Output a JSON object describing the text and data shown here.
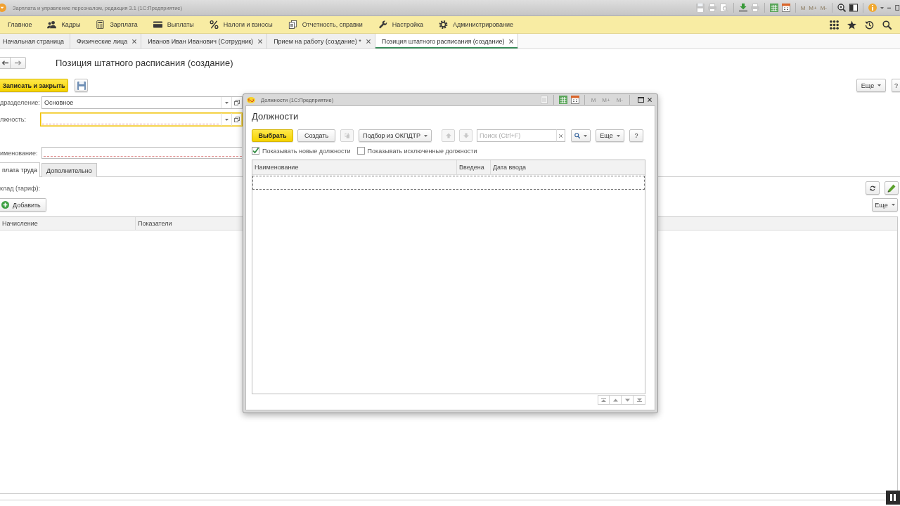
{
  "app_window": {
    "title": "Зарплата и управление персоналом, редакция 3.1  (1С:Предприятие)",
    "memory_buttons": [
      "M",
      "M+",
      "M-"
    ]
  },
  "sections_panel": {
    "items": [
      "Главное",
      "Кадры",
      "Зарплата",
      "Выплаты",
      "Налоги и взносы",
      "Отчетность, справки",
      "Настройка",
      "Администрирование"
    ]
  },
  "open_tabs": [
    {
      "label": "Начальная страница",
      "closable": false,
      "selected": false
    },
    {
      "label": "Физические лица",
      "closable": true,
      "selected": false
    },
    {
      "label": "Иванов Иван Иванович (Сотрудник)",
      "closable": true,
      "selected": false
    },
    {
      "label": "Прием на работу (создание) *",
      "closable": true,
      "selected": false
    },
    {
      "label": "Позиция штатного расписания (создание)",
      "closable": true,
      "selected": true
    }
  ],
  "form": {
    "title": "Позиция штатного расписания (создание)",
    "save_close_button": "Записать и закрыть",
    "more_button": "Еще",
    "help_button": "?",
    "fields": [
      {
        "kind": "choice",
        "label": "дразделение:",
        "value": "Основное",
        "focused": false,
        "needs_value": false
      },
      {
        "kind": "choice",
        "label": "лжность:",
        "focused": true,
        "needs_value": true
      },
      {
        "kind": "text",
        "label": "именование:",
        "focused": false,
        "needs_value": true
      }
    ],
    "tabs": [
      {
        "label": "плата труда",
        "selected": true
      },
      {
        "label": "Дополнительно",
        "selected": false
      }
    ],
    "salary_label": "клад (тариф):",
    "add_button": "Добавить",
    "table_more_button": "Еще",
    "table": {
      "columns": [
        "Начисление",
        "Показатели"
      ]
    }
  },
  "dialog": {
    "title": "Должности  (1С:Предприятие)",
    "memory_buttons": [
      "M",
      "M+",
      "M-"
    ],
    "heading": "Должности",
    "select_button": "Выбрать",
    "create_button": "Создать",
    "copy_button": {
      "disabled": true
    },
    "pick_button": "Подбор из ОКПДТР",
    "move_up_button": {
      "disabled": true
    },
    "move_down_button": {
      "disabled": true
    },
    "search": {
      "placeholder": "Поиск (Ctrl+F)"
    },
    "more_button": "Еще",
    "help_button": "?",
    "options": [
      {
        "label": "Показывать новые должности",
        "checked": true
      },
      {
        "label": "Показывать исключенные должности",
        "checked": false
      }
    ],
    "table": {
      "columns": [
        "Наименование",
        "Введена",
        "Дата ввода"
      ]
    }
  }
}
